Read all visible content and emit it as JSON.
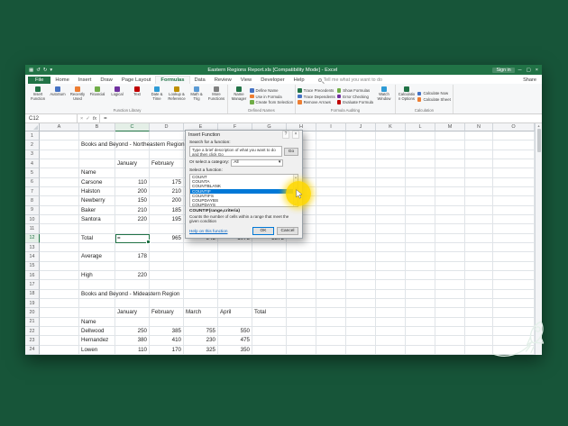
{
  "page": {
    "background_color": "#175539"
  },
  "colors": {
    "excel_green": "#217346",
    "highlight_yellow": "#ffd800",
    "selection_blue": "#0078d7"
  },
  "icons": {
    "save": "▦",
    "undo": "↺",
    "redo": "↻",
    "qat_dropdown": "▾",
    "minimize": "─",
    "maximize": "▢",
    "close": "×",
    "dropdown": "▾",
    "help": "?",
    "cancel": "×",
    "enter": "✓",
    "fx": "fx",
    "up_arrow": "▲",
    "down_arrow": "▼"
  },
  "window": {
    "title": "Eastern Regions Report.xls  [Compatibility Mode] - Excel",
    "sign_in": "Sign in"
  },
  "ribbon": {
    "tabs": [
      "File",
      "Home",
      "Insert",
      "Draw",
      "Page Layout",
      "Formulas",
      "Data",
      "Review",
      "View",
      "Developer",
      "Help"
    ],
    "active_tab": "Formulas",
    "tell_me": "Tell me what you want to do",
    "share": "Share",
    "groups": [
      {
        "label": "Function Library",
        "items": [
          "Insert Function",
          "AutoSum",
          "Recently Used",
          "Financial",
          "Logical",
          "Text",
          "Date & Time",
          "Lookup & Reference",
          "Math & Trig",
          "More Functions"
        ]
      },
      {
        "label": "Defined Names",
        "items": [
          "Name Manager",
          "Define Name",
          "Use in Formula",
          "Create from Selection"
        ]
      },
      {
        "label": "Formula Auditing",
        "items": [
          "Trace Precedents",
          "Trace Dependents",
          "Remove Arrows",
          "Show Formulas",
          "Error Checking",
          "Evaluate Formula",
          "Watch Window"
        ]
      },
      {
        "label": "Calculation",
        "items": [
          "Calculation Options",
          "Calculate Now",
          "Calculate Sheet"
        ]
      }
    ]
  },
  "formula_bar": {
    "name_box": "C12",
    "content": "="
  },
  "sheet": {
    "columns": [
      "A",
      "B",
      "C",
      "D",
      "E",
      "F",
      "G",
      "H",
      "I",
      "J",
      "K",
      "L",
      "M",
      "N",
      "O"
    ],
    "row_count": 24,
    "selection": "C12",
    "cells": [
      {
        "r": 2,
        "c": "B",
        "v": "Books and Beyond - Northeastern Region"
      },
      {
        "r": 4,
        "c": "C",
        "v": "January"
      },
      {
        "r": 4,
        "c": "D",
        "v": "February"
      },
      {
        "r": 5,
        "c": "B",
        "v": "Name"
      },
      {
        "r": 6,
        "c": "B",
        "v": "Carsone"
      },
      {
        "r": 6,
        "c": "C",
        "v": "110"
      },
      {
        "r": 6,
        "c": "D",
        "v": "175"
      },
      {
        "r": 7,
        "c": "B",
        "v": "Halston"
      },
      {
        "r": 7,
        "c": "C",
        "v": "200"
      },
      {
        "r": 7,
        "c": "D",
        "v": "210"
      },
      {
        "r": 8,
        "c": "B",
        "v": "Newberry"
      },
      {
        "r": 8,
        "c": "C",
        "v": "150"
      },
      {
        "r": 8,
        "c": "D",
        "v": "200"
      },
      {
        "r": 9,
        "c": "B",
        "v": "Baker"
      },
      {
        "r": 9,
        "c": "C",
        "v": "210"
      },
      {
        "r": 9,
        "c": "D",
        "v": "185"
      },
      {
        "r": 10,
        "c": "B",
        "v": "Santora"
      },
      {
        "r": 10,
        "c": "C",
        "v": "220"
      },
      {
        "r": 10,
        "c": "D",
        "v": "195"
      },
      {
        "r": 12,
        "c": "B",
        "v": "Total"
      },
      {
        "r": 12,
        "c": "C",
        "v": "="
      },
      {
        "r": 12,
        "c": "D",
        "v": "965"
      },
      {
        "r": 12,
        "c": "E",
        "v": "945"
      },
      {
        "r": 12,
        "c": "F",
        "v": "1075"
      },
      {
        "r": 12,
        "c": "G",
        "v": "3875"
      },
      {
        "r": 14,
        "c": "B",
        "v": "Average"
      },
      {
        "r": 14,
        "c": "C",
        "v": "178"
      },
      {
        "r": 16,
        "c": "B",
        "v": "High"
      },
      {
        "r": 16,
        "c": "C",
        "v": "220"
      },
      {
        "r": 18,
        "c": "B",
        "v": "Books and Beyond - Mideastern Region"
      },
      {
        "r": 20,
        "c": "C",
        "v": "January"
      },
      {
        "r": 20,
        "c": "D",
        "v": "February"
      },
      {
        "r": 20,
        "c": "E",
        "v": "March"
      },
      {
        "r": 20,
        "c": "F",
        "v": "April"
      },
      {
        "r": 20,
        "c": "G",
        "v": "Total"
      },
      {
        "r": 21,
        "c": "B",
        "v": "Name"
      },
      {
        "r": 22,
        "c": "B",
        "v": "Dellwood"
      },
      {
        "r": 22,
        "c": "C",
        "v": "250"
      },
      {
        "r": 22,
        "c": "D",
        "v": "385"
      },
      {
        "r": 22,
        "c": "E",
        "v": "755"
      },
      {
        "r": 22,
        "c": "F",
        "v": "550"
      },
      {
        "r": 23,
        "c": "B",
        "v": "Hernandez"
      },
      {
        "r": 23,
        "c": "C",
        "v": "380"
      },
      {
        "r": 23,
        "c": "D",
        "v": "410"
      },
      {
        "r": 23,
        "c": "E",
        "v": "230"
      },
      {
        "r": 23,
        "c": "F",
        "v": "475"
      },
      {
        "r": 24,
        "c": "B",
        "v": "Lowen"
      },
      {
        "r": 24,
        "c": "C",
        "v": "110"
      },
      {
        "r": 24,
        "c": "D",
        "v": "170"
      },
      {
        "r": 24,
        "c": "E",
        "v": "325"
      },
      {
        "r": 24,
        "c": "F",
        "v": "350"
      }
    ]
  },
  "dialog": {
    "title": "Insert Function",
    "search_label": "Search for a function:",
    "search_hint": "Type a brief description of what you want to do and then click Go",
    "go_button": "Go",
    "category_label": "Or select a category:",
    "category_value": "All",
    "select_label": "Select a function:",
    "functions": [
      "COUNT",
      "COUNTA",
      "COUNTBLANK",
      "COUNTIF",
      "COUNTIFS",
      "COUPDAYBS",
      "COUPDAYS"
    ],
    "selected_function": "COUNTIF",
    "syntax": "COUNTIF(range,criteria)",
    "description": "Counts the number of cells within a range that meet the given condition",
    "help_link": "Help on this function",
    "ok_button": "OK",
    "cancel_button": "Cancel"
  }
}
